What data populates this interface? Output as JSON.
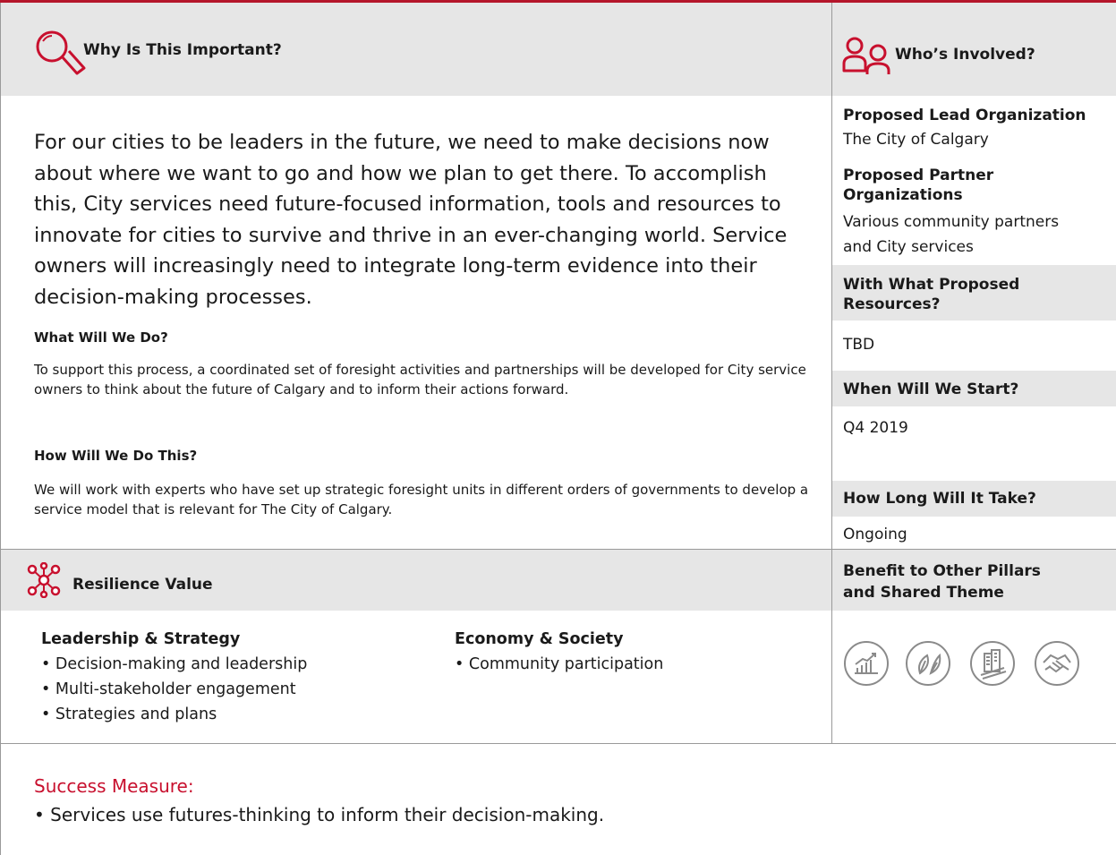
{
  "importance": {
    "title": "Why Is This Important?",
    "icon": "magnifier-icon",
    "intro": "For our cities to be leaders in the future, we need to make decisions now about where we want to go and how we plan to get there. To accomplish this, City services need future-focused information, tools and resources to innovate for cities to survive and thrive in an ever-changing world. Service owners will increasingly need to integrate long-term evidence into their decision-making processes.",
    "what_heading": "What Will We Do?",
    "what_text": "To support this process, a coordinated set of foresight activities and partnerships will be developed for City service owners to think about the future of Calgary and to inform their actions forward.",
    "how_heading": "How Will We Do This?",
    "how_text": "We will work with experts who have set up strategic foresight units in different orders of governments to develop a service model that is relevant for The City of Calgary."
  },
  "involved": {
    "title": "Who’s Involved?",
    "icon": "people-icon",
    "lead_label": "Proposed Lead Organization",
    "lead_value": "The City of Calgary",
    "partner_label_1": "Proposed Partner",
    "partner_label_2": "Organizations",
    "partner_value_1": "Various community partners",
    "partner_value_2": "and City services",
    "resources_label_1": "With What Proposed",
    "resources_label_2": "Resources?",
    "resources_value": "TBD",
    "start_label": "When Will We Start?",
    "start_value": "Q4 2019",
    "duration_label": "How Long Will It Take?",
    "duration_value": "Ongoing"
  },
  "resilience": {
    "title": "Resilience Value",
    "icon": "network-icon",
    "leadership": {
      "heading": "Leadership & Strategy",
      "items": [
        "Decision-making and leadership",
        "Multi-stakeholder engagement",
        "Strategies and plans"
      ]
    },
    "economy": {
      "heading": "Economy & Society",
      "items": [
        "Community participation"
      ]
    }
  },
  "benefit": {
    "title_1": "Benefit to Other Pillars",
    "title_2": "and Shared Theme",
    "icons": [
      "growth-chart-icon",
      "leaves-icon",
      "city-buildings-icon",
      "handshake-icon"
    ]
  },
  "success": {
    "label": "Success Measure:",
    "text": "• Services use futures-thinking to inform their decision-making."
  },
  "colors": {
    "accent": "#c8102e",
    "band_grey": "#e6e6e6",
    "border_grey": "#9a9a9a",
    "icon_grey": "#8a8a8a"
  }
}
